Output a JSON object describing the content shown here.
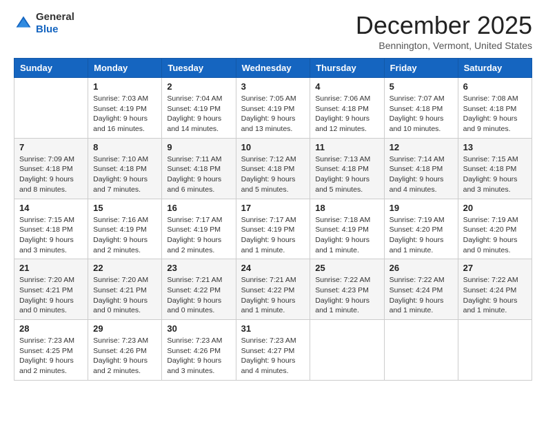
{
  "header": {
    "logo_line1": "General",
    "logo_line2": "Blue",
    "month_title": "December 2025",
    "location": "Bennington, Vermont, United States"
  },
  "calendar": {
    "days_of_week": [
      "Sunday",
      "Monday",
      "Tuesday",
      "Wednesday",
      "Thursday",
      "Friday",
      "Saturday"
    ],
    "weeks": [
      [
        {
          "day": "",
          "info": ""
        },
        {
          "day": "1",
          "info": "Sunrise: 7:03 AM\nSunset: 4:19 PM\nDaylight: 9 hours\nand 16 minutes."
        },
        {
          "day": "2",
          "info": "Sunrise: 7:04 AM\nSunset: 4:19 PM\nDaylight: 9 hours\nand 14 minutes."
        },
        {
          "day": "3",
          "info": "Sunrise: 7:05 AM\nSunset: 4:19 PM\nDaylight: 9 hours\nand 13 minutes."
        },
        {
          "day": "4",
          "info": "Sunrise: 7:06 AM\nSunset: 4:18 PM\nDaylight: 9 hours\nand 12 minutes."
        },
        {
          "day": "5",
          "info": "Sunrise: 7:07 AM\nSunset: 4:18 PM\nDaylight: 9 hours\nand 10 minutes."
        },
        {
          "day": "6",
          "info": "Sunrise: 7:08 AM\nSunset: 4:18 PM\nDaylight: 9 hours\nand 9 minutes."
        }
      ],
      [
        {
          "day": "7",
          "info": "Sunrise: 7:09 AM\nSunset: 4:18 PM\nDaylight: 9 hours\nand 8 minutes."
        },
        {
          "day": "8",
          "info": "Sunrise: 7:10 AM\nSunset: 4:18 PM\nDaylight: 9 hours\nand 7 minutes."
        },
        {
          "day": "9",
          "info": "Sunrise: 7:11 AM\nSunset: 4:18 PM\nDaylight: 9 hours\nand 6 minutes."
        },
        {
          "day": "10",
          "info": "Sunrise: 7:12 AM\nSunset: 4:18 PM\nDaylight: 9 hours\nand 5 minutes."
        },
        {
          "day": "11",
          "info": "Sunrise: 7:13 AM\nSunset: 4:18 PM\nDaylight: 9 hours\nand 5 minutes."
        },
        {
          "day": "12",
          "info": "Sunrise: 7:14 AM\nSunset: 4:18 PM\nDaylight: 9 hours\nand 4 minutes."
        },
        {
          "day": "13",
          "info": "Sunrise: 7:15 AM\nSunset: 4:18 PM\nDaylight: 9 hours\nand 3 minutes."
        }
      ],
      [
        {
          "day": "14",
          "info": "Sunrise: 7:15 AM\nSunset: 4:18 PM\nDaylight: 9 hours\nand 3 minutes."
        },
        {
          "day": "15",
          "info": "Sunrise: 7:16 AM\nSunset: 4:19 PM\nDaylight: 9 hours\nand 2 minutes."
        },
        {
          "day": "16",
          "info": "Sunrise: 7:17 AM\nSunset: 4:19 PM\nDaylight: 9 hours\nand 2 minutes."
        },
        {
          "day": "17",
          "info": "Sunrise: 7:17 AM\nSunset: 4:19 PM\nDaylight: 9 hours\nand 1 minute."
        },
        {
          "day": "18",
          "info": "Sunrise: 7:18 AM\nSunset: 4:19 PM\nDaylight: 9 hours\nand 1 minute."
        },
        {
          "day": "19",
          "info": "Sunrise: 7:19 AM\nSunset: 4:20 PM\nDaylight: 9 hours\nand 1 minute."
        },
        {
          "day": "20",
          "info": "Sunrise: 7:19 AM\nSunset: 4:20 PM\nDaylight: 9 hours\nand 0 minutes."
        }
      ],
      [
        {
          "day": "21",
          "info": "Sunrise: 7:20 AM\nSunset: 4:21 PM\nDaylight: 9 hours\nand 0 minutes."
        },
        {
          "day": "22",
          "info": "Sunrise: 7:20 AM\nSunset: 4:21 PM\nDaylight: 9 hours\nand 0 minutes."
        },
        {
          "day": "23",
          "info": "Sunrise: 7:21 AM\nSunset: 4:22 PM\nDaylight: 9 hours\nand 0 minutes."
        },
        {
          "day": "24",
          "info": "Sunrise: 7:21 AM\nSunset: 4:22 PM\nDaylight: 9 hours\nand 1 minute."
        },
        {
          "day": "25",
          "info": "Sunrise: 7:22 AM\nSunset: 4:23 PM\nDaylight: 9 hours\nand 1 minute."
        },
        {
          "day": "26",
          "info": "Sunrise: 7:22 AM\nSunset: 4:24 PM\nDaylight: 9 hours\nand 1 minute."
        },
        {
          "day": "27",
          "info": "Sunrise: 7:22 AM\nSunset: 4:24 PM\nDaylight: 9 hours\nand 1 minute."
        }
      ],
      [
        {
          "day": "28",
          "info": "Sunrise: 7:23 AM\nSunset: 4:25 PM\nDaylight: 9 hours\nand 2 minutes."
        },
        {
          "day": "29",
          "info": "Sunrise: 7:23 AM\nSunset: 4:26 PM\nDaylight: 9 hours\nand 2 minutes."
        },
        {
          "day": "30",
          "info": "Sunrise: 7:23 AM\nSunset: 4:26 PM\nDaylight: 9 hours\nand 3 minutes."
        },
        {
          "day": "31",
          "info": "Sunrise: 7:23 AM\nSunset: 4:27 PM\nDaylight: 9 hours\nand 4 minutes."
        },
        {
          "day": "",
          "info": ""
        },
        {
          "day": "",
          "info": ""
        },
        {
          "day": "",
          "info": ""
        }
      ]
    ]
  }
}
